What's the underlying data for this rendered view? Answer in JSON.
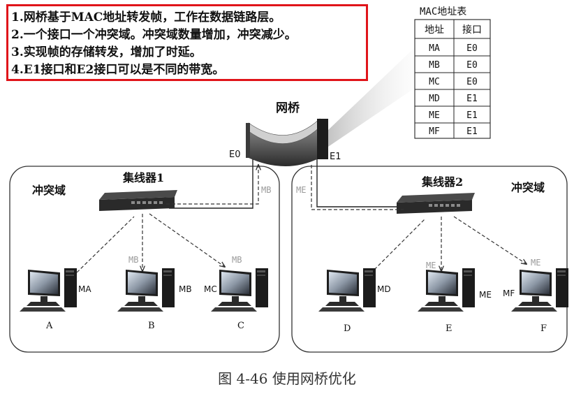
{
  "notes": [
    "1.网桥基于MAC地址转发帧，工作在数据链路层。",
    "2.一个接口一个冲突域。冲突域数量增加，冲突减少。",
    "3.实现帧的存储转发，增加了时延。",
    "4.E1接口和E2接口可以是不同的带宽。"
  ],
  "mac_table": {
    "title": "MAC地址表",
    "headers": [
      "地址",
      "接口"
    ],
    "rows": [
      [
        "MA",
        "E0"
      ],
      [
        "MB",
        "E0"
      ],
      [
        "MC",
        "E0"
      ],
      [
        "MD",
        "E1"
      ],
      [
        "ME",
        "E1"
      ],
      [
        "MF",
        "E1"
      ]
    ]
  },
  "bridge": {
    "label": "网桥",
    "port_left": "E0",
    "port_right": "E1"
  },
  "left_domain": {
    "label": "冲突域",
    "hub": "集线器1",
    "hosts": [
      {
        "mac": "MA",
        "name": "A"
      },
      {
        "mac": "MB",
        "name": "B"
      },
      {
        "mac": "MC",
        "name": "C"
      }
    ],
    "arrow_labels": {
      "to_b": "MB",
      "to_c": "MB",
      "to_bridge": "MB"
    }
  },
  "right_domain": {
    "label": "冲突域",
    "hub": "集线器2",
    "hosts": [
      {
        "mac": "MD",
        "name": "D"
      },
      {
        "mac": "ME",
        "name": "E"
      },
      {
        "mac": "MF",
        "name": "F"
      }
    ],
    "arrow_labels": {
      "from_bridge": "ME",
      "to_e": "ME",
      "to_f": "ME"
    }
  },
  "caption": "图 4-46    使用网桥优化",
  "colors": {
    "note_border": "#e0141a",
    "frame_label": "#9a9a9a",
    "line": "#222222"
  }
}
